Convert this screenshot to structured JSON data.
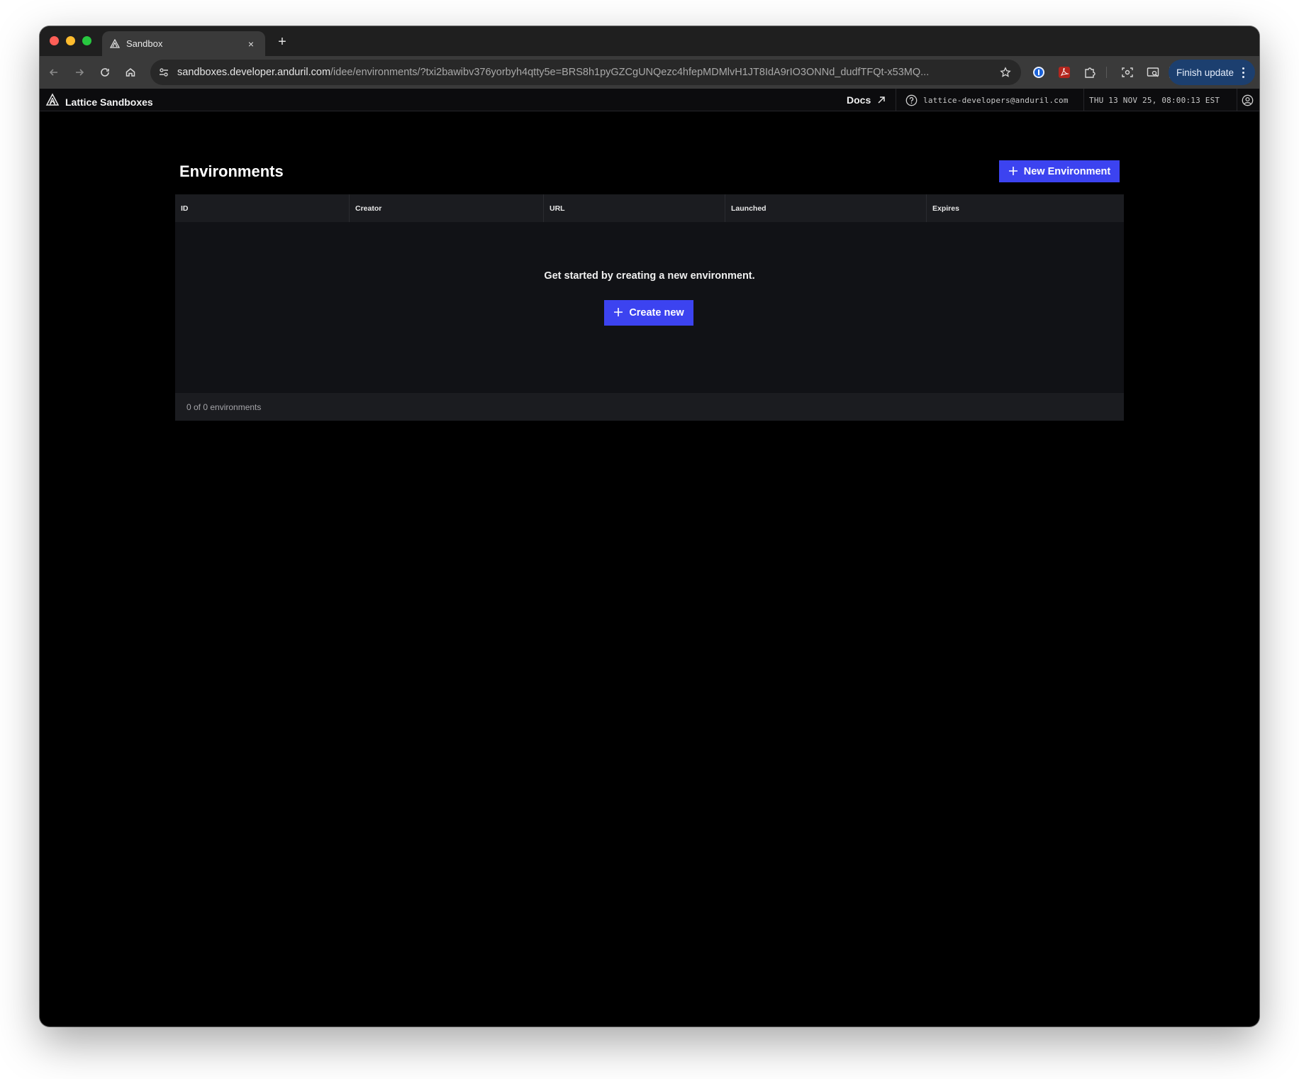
{
  "browser": {
    "tab": {
      "title": "Sandbox",
      "close_label": "×"
    },
    "new_tab_label": "+",
    "url": {
      "host": "sandboxes.developer.anduril.com",
      "path": "/idee/environments/?txi2bawibv376yorbyh4qtty5e=BRS8h1pyGZCgUNQezc4hfepMDMlvH1JT8IdA9rIO3ONNd_dudfTFQt-x53MQ..."
    },
    "finish_update_label": "Finish update",
    "icons": {
      "back": "arrow-left-icon",
      "forward": "arrow-right-icon",
      "reload": "reload-icon",
      "home": "home-icon",
      "site_info": "tune-icon",
      "bookmark": "star-icon",
      "password_manager": "1password-icon",
      "pdf": "acrobat-icon",
      "extensions": "puzzle-icon",
      "screenshot": "camera-capture-icon",
      "cast": "cast-search-icon",
      "profile": "avatar-icon",
      "menu": "kebab-menu-icon"
    }
  },
  "app": {
    "brand": "Lattice Sandboxes",
    "docs_label": "Docs",
    "user_email": "lattice-developers@anduril.com",
    "datetime": "THU 13 NOV 25, 08:00:13 EST",
    "accent_color": "#3c43f0"
  },
  "environments": {
    "title": "Environments",
    "new_button_label": "New Environment",
    "columns": [
      "ID",
      "Creator",
      "URL",
      "Launched",
      "Expires"
    ],
    "rows": [],
    "empty_message": "Get started by creating a new environment.",
    "create_button_label": "Create new",
    "footer_count": "0 of 0 environments"
  }
}
